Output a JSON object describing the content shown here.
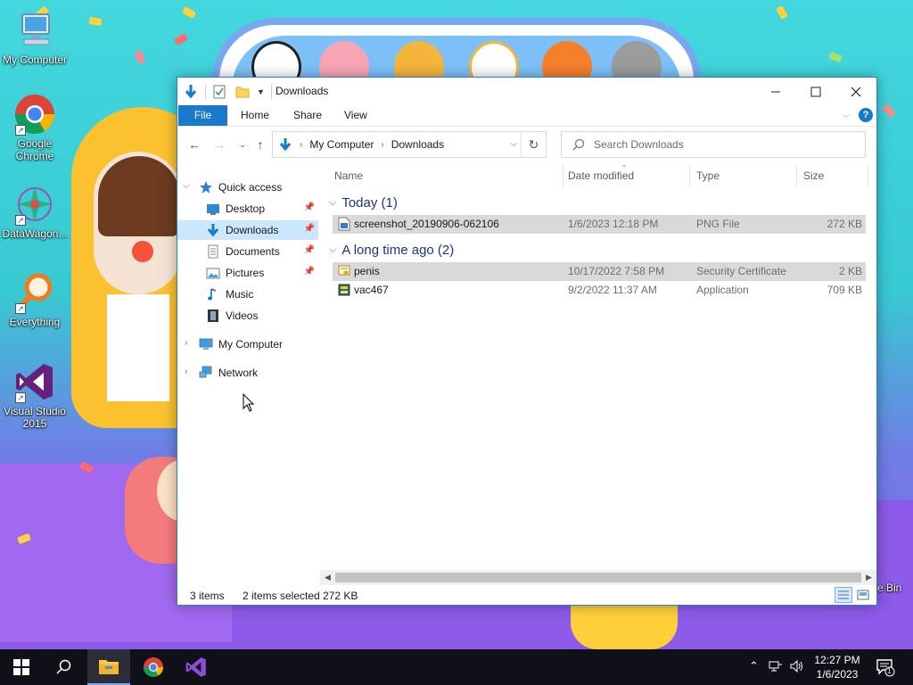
{
  "desktop": {
    "icons": [
      {
        "label": "My Computer"
      },
      {
        "label": "Google Chrome"
      },
      {
        "label": "DataWagon..."
      },
      {
        "label": "Everything"
      },
      {
        "label": "Visual Studio 2015"
      }
    ],
    "recycle_partial": "e Bin"
  },
  "window": {
    "title": "Downloads",
    "ribbon_tabs": [
      "File",
      "Home",
      "Share",
      "View"
    ],
    "breadcrumb": [
      "My Computer",
      "Downloads"
    ],
    "search_placeholder": "Search Downloads",
    "nav": {
      "quick_access": "Quick access",
      "items": [
        "Desktop",
        "Downloads",
        "Documents",
        "Pictures",
        "Music",
        "Videos"
      ],
      "my_computer": "My Computer",
      "network": "Network"
    },
    "columns": {
      "name": "Name",
      "date": "Date modified",
      "type": "Type",
      "size": "Size"
    },
    "groups": [
      {
        "header": "Today (1)",
        "files": [
          {
            "name": "screenshot_20190906-062106",
            "date": "1/6/2023 12:18 PM",
            "type": "PNG File",
            "size": "272 KB",
            "selected": true
          }
        ]
      },
      {
        "header": "A long time ago (2)",
        "files": [
          {
            "name": "penis",
            "date": "10/17/2022 7:58 PM",
            "type": "Security Certificate",
            "size": "2 KB",
            "selected": true
          },
          {
            "name": "vac467",
            "date": "9/2/2022 11:37 AM",
            "type": "Application",
            "size": "709 KB",
            "selected": false
          }
        ]
      }
    ],
    "status": {
      "items": "3 items",
      "selected": "2 items selected",
      "size": "272 KB"
    }
  },
  "taskbar": {
    "time": "12:27 PM",
    "date": "1/6/2023",
    "notification_count": "1"
  },
  "colors": {
    "accent": "#1979ca",
    "selection": "#cce8ff",
    "group_header": "#1e3287"
  }
}
